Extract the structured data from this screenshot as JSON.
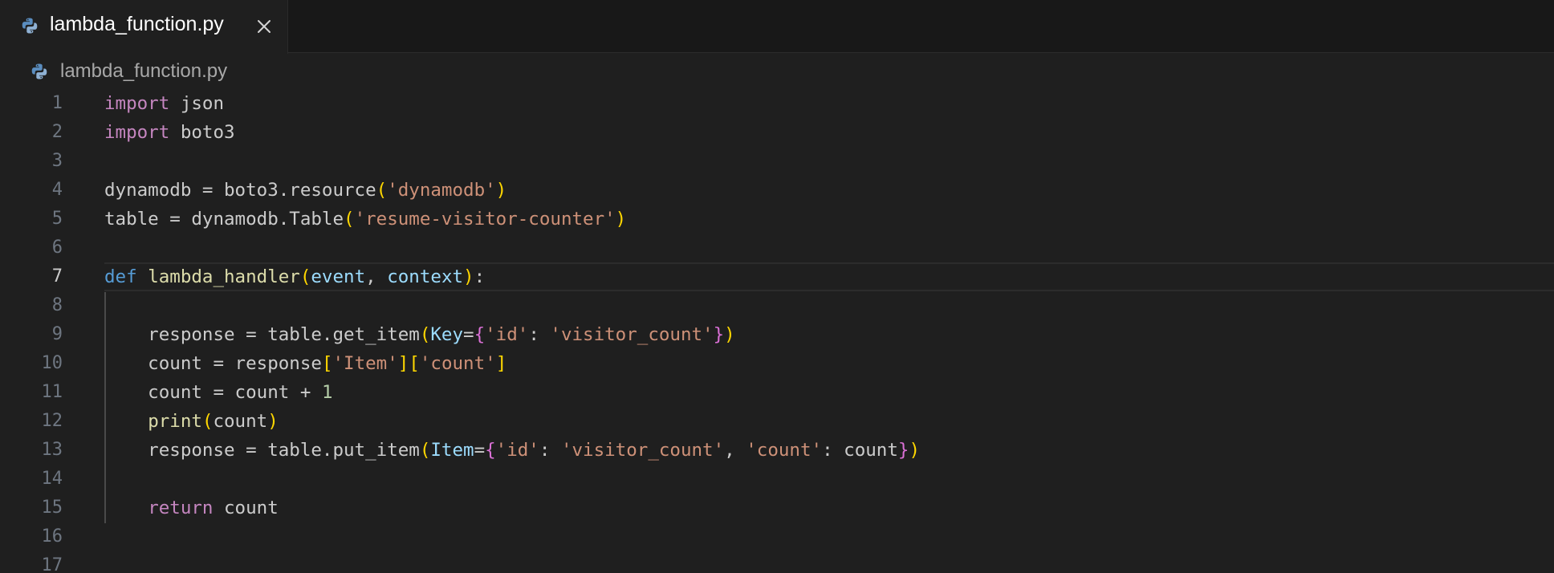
{
  "tab": {
    "filename": "lambda_function.py",
    "icon": "python-icon"
  },
  "breadcrumb": {
    "filename": "lambda_function.py",
    "icon": "python-icon"
  },
  "editor": {
    "active_line": 7,
    "lines": [
      {
        "n": "1",
        "tokens": [
          [
            "kw",
            "import"
          ],
          [
            "txt",
            " json"
          ]
        ]
      },
      {
        "n": "2",
        "tokens": [
          [
            "kw",
            "import"
          ],
          [
            "txt",
            " boto3"
          ]
        ]
      },
      {
        "n": "3",
        "tokens": []
      },
      {
        "n": "4",
        "tokens": [
          [
            "txt",
            "dynamodb = boto3.resource"
          ],
          [
            "p1",
            "("
          ],
          [
            "str",
            "'dynamodb'"
          ],
          [
            "p1",
            ")"
          ]
        ]
      },
      {
        "n": "5",
        "tokens": [
          [
            "txt",
            "table = dynamodb.Table"
          ],
          [
            "p1",
            "("
          ],
          [
            "str",
            "'resume-visitor-counter'"
          ],
          [
            "p1",
            ")"
          ]
        ]
      },
      {
        "n": "6",
        "tokens": []
      },
      {
        "n": "7",
        "tokens": [
          [
            "def",
            "def"
          ],
          [
            "txt",
            " "
          ],
          [
            "fn",
            "lambda_handler"
          ],
          [
            "p1",
            "("
          ],
          [
            "param",
            "event"
          ],
          [
            "txt",
            ", "
          ],
          [
            "param",
            "context"
          ],
          [
            "p1",
            ")"
          ],
          [
            "txt",
            ":"
          ]
        ]
      },
      {
        "n": "8",
        "tokens": []
      },
      {
        "n": "9",
        "tokens": [
          [
            "txt",
            "    response = table.get_item"
          ],
          [
            "p1",
            "("
          ],
          [
            "param",
            "Key"
          ],
          [
            "txt",
            "="
          ],
          [
            "p2",
            "{"
          ],
          [
            "str",
            "'id'"
          ],
          [
            "txt",
            ": "
          ],
          [
            "str",
            "'visitor_count'"
          ],
          [
            "p2",
            "}"
          ],
          [
            "p1",
            ")"
          ]
        ]
      },
      {
        "n": "10",
        "tokens": [
          [
            "txt",
            "    count = response"
          ],
          [
            "p1",
            "["
          ],
          [
            "str",
            "'Item'"
          ],
          [
            "p1",
            "]"
          ],
          [
            "p1",
            "["
          ],
          [
            "str",
            "'count'"
          ],
          [
            "p1",
            "]"
          ]
        ]
      },
      {
        "n": "11",
        "tokens": [
          [
            "txt",
            "    count = count + "
          ],
          [
            "num",
            "1"
          ]
        ]
      },
      {
        "n": "12",
        "tokens": [
          [
            "txt",
            "    "
          ],
          [
            "fn",
            "print"
          ],
          [
            "p1",
            "("
          ],
          [
            "txt",
            "count"
          ],
          [
            "p1",
            ")"
          ]
        ]
      },
      {
        "n": "13",
        "tokens": [
          [
            "txt",
            "    response = table.put_item"
          ],
          [
            "p1",
            "("
          ],
          [
            "param",
            "Item"
          ],
          [
            "txt",
            "="
          ],
          [
            "p2",
            "{"
          ],
          [
            "str",
            "'id'"
          ],
          [
            "txt",
            ": "
          ],
          [
            "str",
            "'visitor_count'"
          ],
          [
            "txt",
            ", "
          ],
          [
            "str",
            "'count'"
          ],
          [
            "txt",
            ": count"
          ],
          [
            "p2",
            "}"
          ],
          [
            "p1",
            ")"
          ]
        ]
      },
      {
        "n": "14",
        "tokens": []
      },
      {
        "n": "15",
        "tokens": [
          [
            "txt",
            "    "
          ],
          [
            "kw",
            "return"
          ],
          [
            "txt",
            " count"
          ]
        ]
      },
      {
        "n": "16",
        "tokens": []
      },
      {
        "n": "17",
        "tokens": []
      }
    ]
  }
}
